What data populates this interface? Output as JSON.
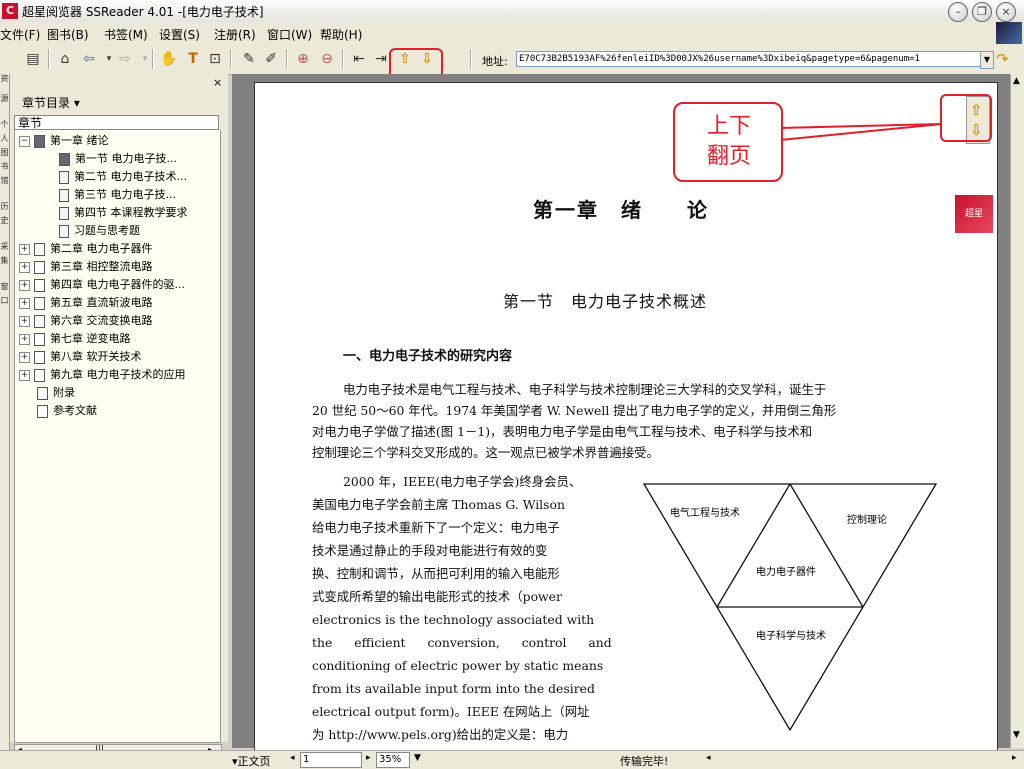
{
  "window": {
    "title": "超星阅览器 SSReader 4.01 -[电力电子技术]",
    "app_icon_glyph": "C",
    "controls": {
      "minimize": "–",
      "restore": "❐",
      "close": "×"
    }
  },
  "menu": {
    "items": [
      "文件(F)",
      "图书(B)",
      "书签(M)",
      "设置(S)",
      "注册(R)",
      "窗口(W)",
      "帮助(H)"
    ]
  },
  "toolbar": {
    "icons": [
      "book-icon",
      "home-icon",
      "back-arrow-icon",
      "forward-arrow-icon",
      "hand-tool-icon",
      "text-tool-icon",
      "select-region-icon",
      "annotate-icon",
      "pen-icon",
      "zoom-in-icon",
      "zoom-out-icon",
      "first-page-icon",
      "last-page-icon",
      "page-up-icon",
      "page-down-icon"
    ],
    "address_label": "地址:",
    "address_value": "E70C73B2B5193AF%26fenleiID%3D00JX%26username%3Dxibeiq&pagetype=6&pagenum=1"
  },
  "left_strip": {
    "tabs": [
      "资",
      "源",
      "个",
      "人",
      "图",
      "书",
      "馆",
      "历",
      "史",
      "采",
      "集",
      "窗",
      "口"
    ]
  },
  "sidebar": {
    "chapter_dir_label": "章节目录 ▾",
    "close_glyph": "×",
    "tree_header": "章节",
    "tree": [
      {
        "expander": "−",
        "label": "第一章 绪论",
        "level": 0
      },
      {
        "expander": "",
        "label": "第一节 电力电子技...",
        "level": 1,
        "dark": true
      },
      {
        "expander": "",
        "label": "第二节 电力电子技术...",
        "level": 1
      },
      {
        "expander": "",
        "label": "第三节 电力电子技...",
        "level": 1
      },
      {
        "expander": "",
        "label": "第四节 本课程教学要求",
        "level": 1
      },
      {
        "expander": "",
        "label": "习题与思考题",
        "level": 1
      },
      {
        "expander": "+",
        "label": "第二章 电力电子器件",
        "level": 0
      },
      {
        "expander": "+",
        "label": "第三章 相控整流电路",
        "level": 0
      },
      {
        "expander": "+",
        "label": "第四章 电力电子器件的驱...",
        "level": 0
      },
      {
        "expander": "+",
        "label": "第五章 直流斩波电路",
        "level": 0
      },
      {
        "expander": "+",
        "label": "第六章 交流变换电路",
        "level": 0
      },
      {
        "expander": "+",
        "label": "第七章 逆变电路",
        "level": 0
      },
      {
        "expander": "+",
        "label": "第八章 软开关技术",
        "level": 0
      },
      {
        "expander": "+",
        "label": "第九章 电力电子技术的应用",
        "level": 0
      },
      {
        "expander": "",
        "label": "附录",
        "level": 0
      },
      {
        "expander": "",
        "label": "参考文献",
        "level": 0
      }
    ]
  },
  "document": {
    "chapter_title": "第一章　绪　　论",
    "section_title": "第一节　电力电子技术概述",
    "subsection_title": "一、电力电子技术的研究内容",
    "para1": [
      "电力电子技术是电气工程与技术、电子科学与技术控制理论三大学科的交叉学科，诞生于",
      "20 世纪 50～60 年代。1974 年美国学者 W. Newell 提出了电力电子学的定义，并用倒三角形",
      "对电力电子学做了描述(图 1－1)，表明电力电子学是由电气工程与技术、电子科学与技术和",
      "控制理论三个学科交叉形成的。这一观点已被学术界普遍接受。"
    ],
    "para2": [
      "2000 年，IEEE(电力电子学会)终身会员、",
      "美国电力电子学会前主席 Thomas G. Wilson",
      "给电力电子技术重新下了一个定义：电力电子",
      "技术是通过静止的手段对电能进行有效的变",
      "换、控制和调节，从而把可利用的输入电能形",
      "式变成所希望的输出电能形式的技术（power",
      "electronics is the technology associated with",
      "the efficient conversion, control and",
      "conditioning of electric power by static means",
      "from its available input form into the desired",
      "electrical output form)。IEEE 在网站上（网址",
      "为 http://www.pels.org)给出的定义是：电力"
    ],
    "diagram": {
      "labels": {
        "left": "电气工程与技术",
        "right": "控制理论",
        "center": "电力电子器件",
        "bottom": "电子科学与技术"
      }
    },
    "stamp_text": "超星"
  },
  "callout": {
    "text": "上下翻页"
  },
  "statusbar": {
    "mode": "▾正文页",
    "page_input": "1",
    "zoom": "35%",
    "status": "传输完毕!"
  }
}
